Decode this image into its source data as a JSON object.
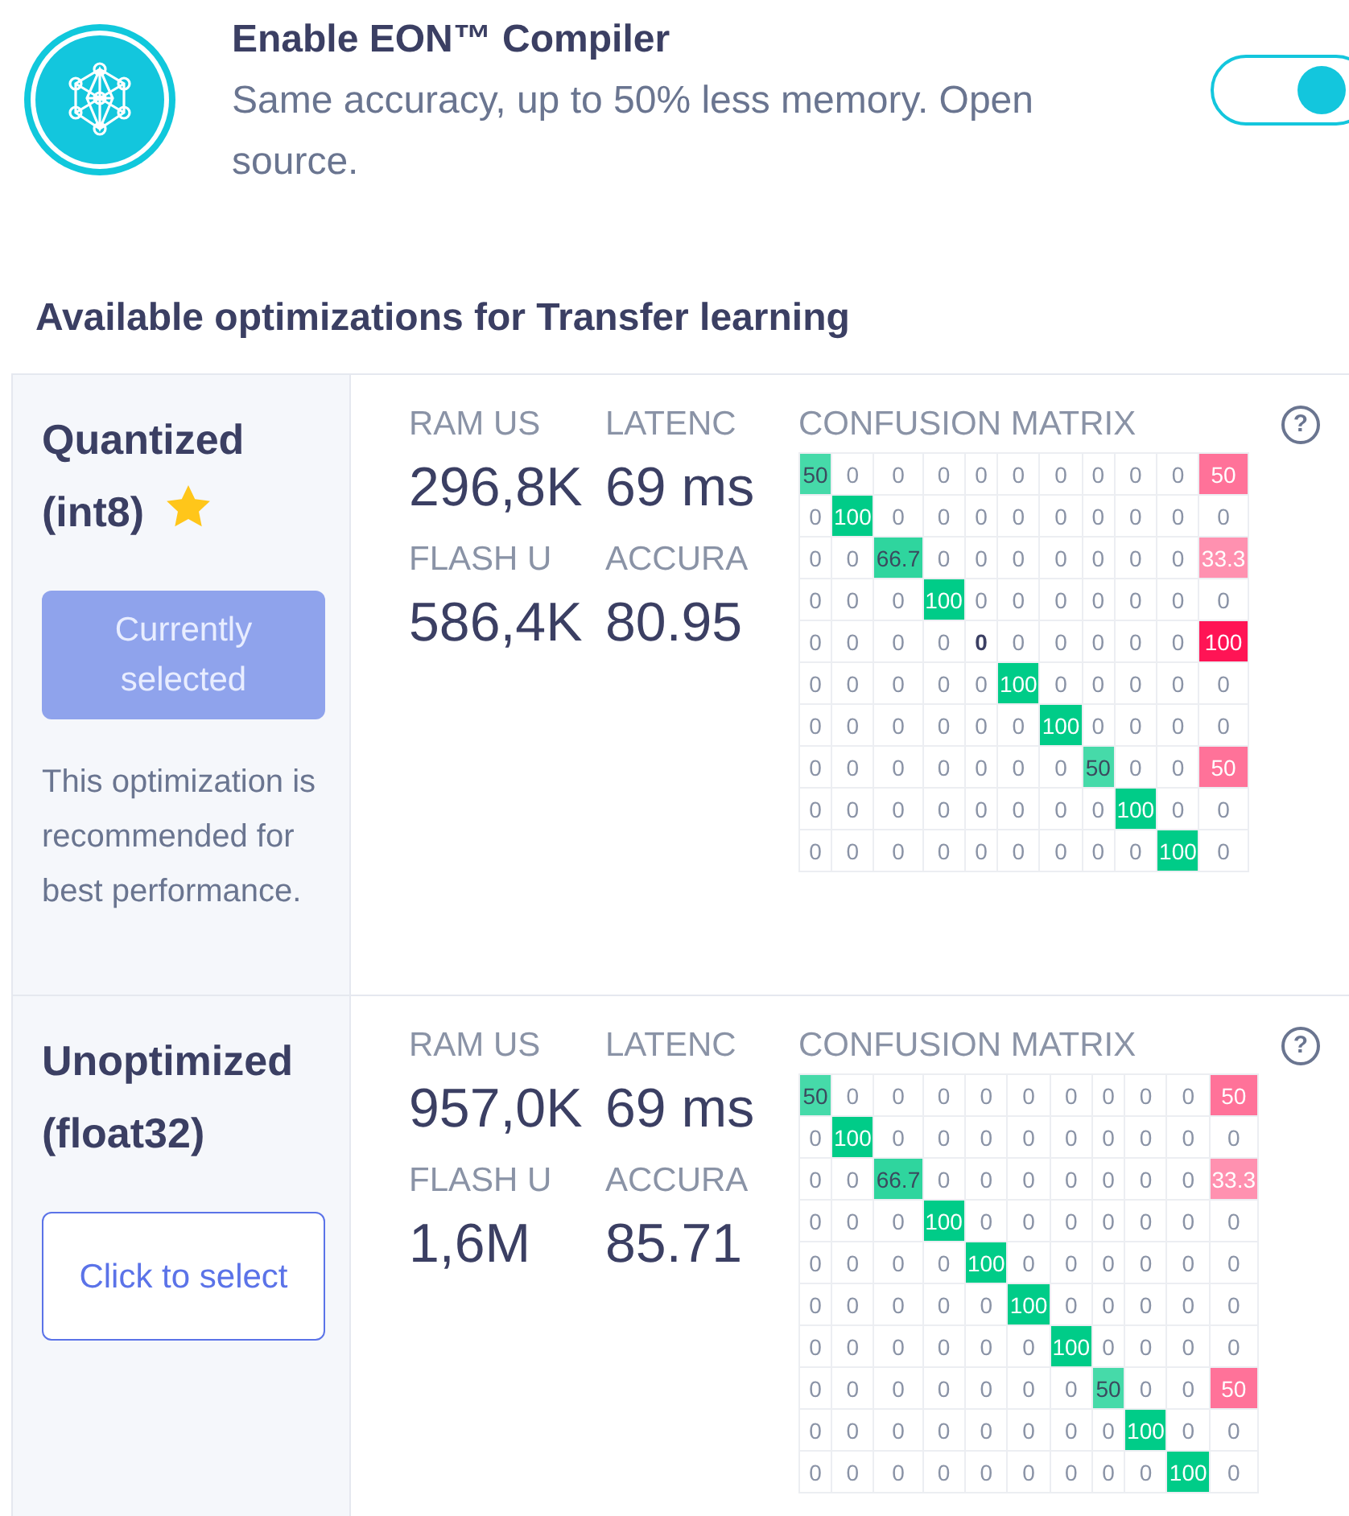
{
  "compiler": {
    "title": "Enable EON™ Compiler",
    "description": "Same accuracy, up to 50% less memory. Open source.",
    "on": true
  },
  "section_title": "Available optimizations for Transfer learning",
  "optimizations": [
    {
      "title": "Quantized (int8)",
      "recommended": true,
      "selected": true,
      "button": "Currently selected",
      "note": "This optimization is recommended for best performance.",
      "metrics": [
        {
          "label": "RAM US",
          "value": "296,8K"
        },
        {
          "label": "LATENC",
          "value": "69 ms"
        },
        {
          "label": "FLASH U",
          "value": "586,4K"
        },
        {
          "label": "ACCURA",
          "value": "80.95"
        }
      ],
      "matrix": {
        "title": "CONFUSION MATRIX",
        "help": "?",
        "rows": [
          [
            "50",
            "0",
            "0",
            "0",
            "0",
            "0",
            "0",
            "0",
            "0",
            "0",
            "50"
          ],
          [
            "0",
            "100",
            "0",
            "0",
            "0",
            "0",
            "0",
            "0",
            "0",
            "0",
            "0"
          ],
          [
            "0",
            "0",
            "66.7",
            "0",
            "0",
            "0",
            "0",
            "0",
            "0",
            "0",
            "33.3"
          ],
          [
            "0",
            "0",
            "0",
            "100",
            "0",
            "0",
            "0",
            "0",
            "0",
            "0",
            "0"
          ],
          [
            "0",
            "0",
            "0",
            "0",
            "0",
            "0",
            "0",
            "0",
            "0",
            "0",
            "100"
          ],
          [
            "0",
            "0",
            "0",
            "0",
            "0",
            "100",
            "0",
            "0",
            "0",
            "0",
            "0"
          ],
          [
            "0",
            "0",
            "0",
            "0",
            "0",
            "0",
            "100",
            "0",
            "0",
            "0",
            "0"
          ],
          [
            "0",
            "0",
            "0",
            "0",
            "0",
            "0",
            "0",
            "50",
            "0",
            "0",
            "50"
          ],
          [
            "0",
            "0",
            "0",
            "0",
            "0",
            "0",
            "0",
            "0",
            "100",
            "0",
            "0"
          ],
          [
            "0",
            "0",
            "0",
            "0",
            "0",
            "0",
            "0",
            "0",
            "0",
            "100",
            "0"
          ]
        ]
      }
    },
    {
      "title": "Unoptimized (float32)",
      "recommended": false,
      "selected": false,
      "button": "Click to select",
      "metrics": [
        {
          "label": "RAM US",
          "value": "957,0K"
        },
        {
          "label": "LATENC",
          "value": "69 ms"
        },
        {
          "label": "FLASH U",
          "value": "1,6M"
        },
        {
          "label": "ACCURA",
          "value": "85.71"
        }
      ],
      "matrix": {
        "title": "CONFUSION MATRIX",
        "help": "?",
        "rows": [
          [
            "50",
            "0",
            "0",
            "0",
            "0",
            "0",
            "0",
            "0",
            "0",
            "0",
            "50"
          ],
          [
            "0",
            "100",
            "0",
            "0",
            "0",
            "0",
            "0",
            "0",
            "0",
            "0",
            "0"
          ],
          [
            "0",
            "0",
            "66.7",
            "0",
            "0",
            "0",
            "0",
            "0",
            "0",
            "0",
            "33.3"
          ],
          [
            "0",
            "0",
            "0",
            "100",
            "0",
            "0",
            "0",
            "0",
            "0",
            "0",
            "0"
          ],
          [
            "0",
            "0",
            "0",
            "0",
            "100",
            "0",
            "0",
            "0",
            "0",
            "0",
            "0"
          ],
          [
            "0",
            "0",
            "0",
            "0",
            "0",
            "100",
            "0",
            "0",
            "0",
            "0",
            "0"
          ],
          [
            "0",
            "0",
            "0",
            "0",
            "0",
            "0",
            "100",
            "0",
            "0",
            "0",
            "0"
          ],
          [
            "0",
            "0",
            "0",
            "0",
            "0",
            "0",
            "0",
            "50",
            "0",
            "0",
            "50"
          ],
          [
            "0",
            "0",
            "0",
            "0",
            "0",
            "0",
            "0",
            "0",
            "100",
            "0",
            "0"
          ],
          [
            "0",
            "0",
            "0",
            "0",
            "0",
            "0",
            "0",
            "0",
            "0",
            "100",
            "0"
          ]
        ]
      }
    }
  ]
}
